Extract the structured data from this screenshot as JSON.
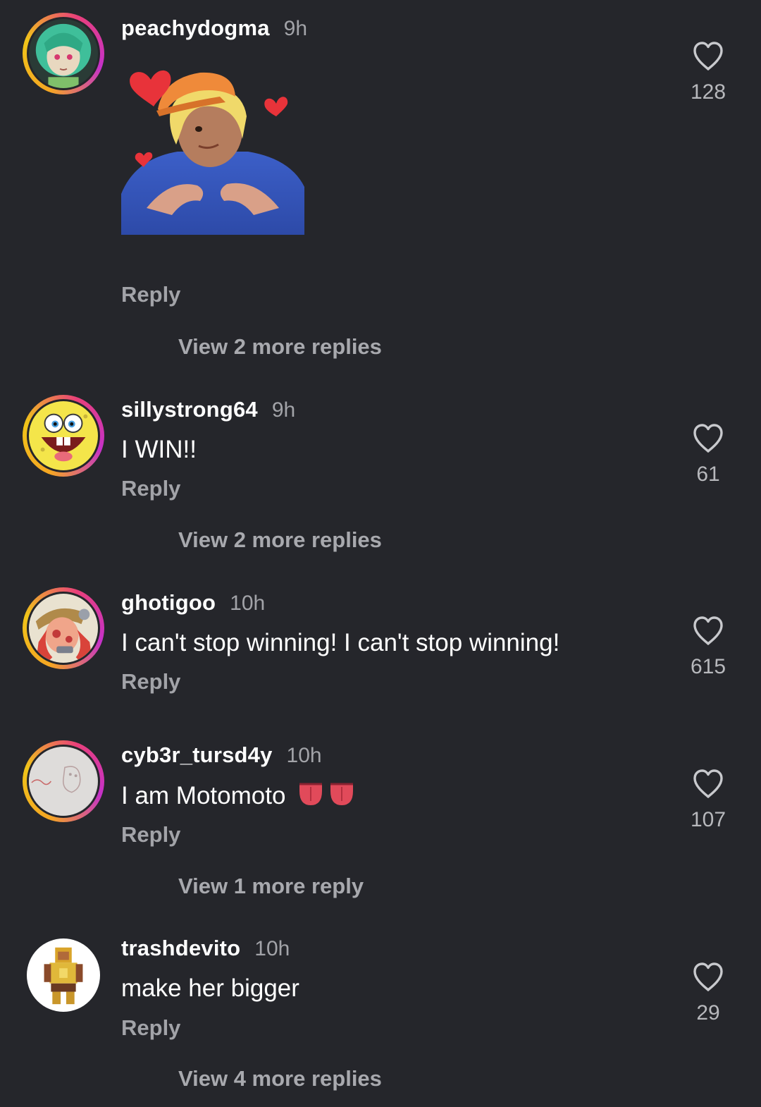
{
  "comments": [
    {
      "username": "peachydogma",
      "time": "9h",
      "text": "",
      "reply": "Reply",
      "likes": "128",
      "view_more": "View 2 more replies",
      "avatar": "anime-green-hair-avatar",
      "has_sticker": true
    },
    {
      "username": "sillystrong64",
      "time": "9h",
      "text": "I WIN!!",
      "reply": "Reply",
      "likes": "61",
      "view_more": "View 2 more replies",
      "avatar": "sponge-cartoon-avatar"
    },
    {
      "username": "ghotigoo",
      "time": "10h",
      "text": "I can't stop winning! I can't stop winning!",
      "reply": "Reply",
      "likes": "615",
      "view_more": "",
      "avatar": "cartoon-character-avatar"
    },
    {
      "username": "cyb3r_tursd4y",
      "time": "10h",
      "text": "I am Motomoto",
      "emoji": "tongue-emoji",
      "reply": "Reply",
      "likes": "107",
      "view_more": "View 1 more reply",
      "avatar": "sketch-drawing-avatar"
    },
    {
      "username": "trashdevito",
      "time": "10h",
      "text": "make her bigger",
      "reply": "Reply",
      "likes": "29",
      "view_more": "View 4 more replies",
      "avatar": "pixel-warrior-avatar"
    }
  ],
  "colors": {
    "background": "#25262b",
    "username": "#ffffff",
    "secondary": "#a2a3a8",
    "story_ring_start": "#f5a623",
    "story_ring_end": "#c531c9"
  },
  "icons": {
    "like": "heart-outline-icon"
  }
}
